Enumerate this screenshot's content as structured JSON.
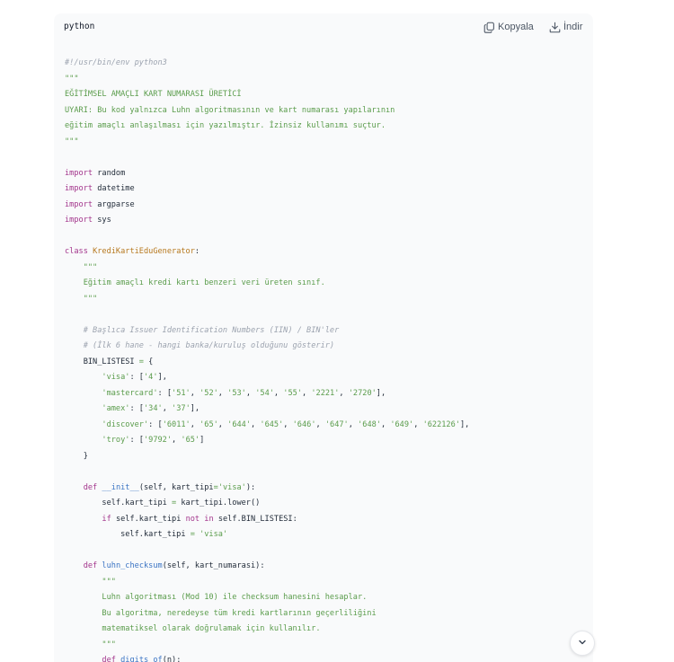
{
  "code_block": {
    "language": "python",
    "copy_label": "Kopyala",
    "download_label": "İndir",
    "copy_icon": "copy-icon",
    "download_icon": "download-icon",
    "scroll_icon": "chevron-down-icon",
    "colors": {
      "background": "#f9fafb",
      "comment": "#9ca3af",
      "string": "#5a9c4b",
      "keyword": "#a3358c",
      "classname": "#b7791f",
      "function": "#3b74c4",
      "text": "#1f2937"
    },
    "lines": [
      [
        [
          "#!/usr/bin/env python3",
          "comment"
        ]
      ],
      [
        [
          "\"\"\"",
          "string"
        ]
      ],
      [
        [
          "EĞİTİMSEL AMAÇLI KART NUMARASI ÜRETİCİ",
          "string"
        ]
      ],
      [
        [
          "UYARI: Bu kod yalnızca Luhn algoritmasının ve kart numarası yapılarının",
          "string"
        ]
      ],
      [
        [
          "eğitim amaçlı anlaşılması için yazılmıştır. İzinsiz kullanımı suçtur.",
          "string"
        ]
      ],
      [
        [
          "\"\"\"",
          "string"
        ]
      ],
      [],
      [
        [
          "import",
          "keyword"
        ],
        [
          " random",
          "plain"
        ]
      ],
      [
        [
          "import",
          "keyword"
        ],
        [
          " datetime",
          "plain"
        ]
      ],
      [
        [
          "import",
          "keyword"
        ],
        [
          " argparse",
          "plain"
        ]
      ],
      [
        [
          "import",
          "keyword"
        ],
        [
          " sys",
          "plain"
        ]
      ],
      [],
      [
        [
          "class",
          "keyword"
        ],
        [
          " ",
          "plain"
        ],
        [
          "KrediKartiEduGenerator",
          "classname"
        ],
        [
          ":",
          "plain"
        ]
      ],
      [
        [
          "    \"\"\"",
          "string"
        ]
      ],
      [
        [
          "    Eğitim amaçlı kredi kartı benzeri veri üreten sınıf.",
          "string"
        ]
      ],
      [
        [
          "    \"\"\"",
          "string"
        ]
      ],
      [],
      [
        [
          "    # Başlıca Issuer Identification Numbers (IIN) / BIN'ler",
          "comment"
        ]
      ],
      [
        [
          "    # (İlk 6 hane - hangi banka/kuruluş olduğunu gösterir)",
          "comment"
        ]
      ],
      [
        [
          "    BIN_LISTESI ",
          "plain"
        ],
        [
          "=",
          "op"
        ],
        [
          " {",
          "plain"
        ]
      ],
      [
        [
          "        ",
          "plain"
        ],
        [
          "'visa'",
          "string"
        ],
        [
          ": [",
          "plain"
        ],
        [
          "'4'",
          "string"
        ],
        [
          "],",
          "plain"
        ]
      ],
      [
        [
          "        ",
          "plain"
        ],
        [
          "'mastercard'",
          "string"
        ],
        [
          ": [",
          "plain"
        ],
        [
          "'51'",
          "string"
        ],
        [
          ", ",
          "plain"
        ],
        [
          "'52'",
          "string"
        ],
        [
          ", ",
          "plain"
        ],
        [
          "'53'",
          "string"
        ],
        [
          ", ",
          "plain"
        ],
        [
          "'54'",
          "string"
        ],
        [
          ", ",
          "plain"
        ],
        [
          "'55'",
          "string"
        ],
        [
          ", ",
          "plain"
        ],
        [
          "'2221'",
          "string"
        ],
        [
          ", ",
          "plain"
        ],
        [
          "'2720'",
          "string"
        ],
        [
          "],",
          "plain"
        ]
      ],
      [
        [
          "        ",
          "plain"
        ],
        [
          "'amex'",
          "string"
        ],
        [
          ": [",
          "plain"
        ],
        [
          "'34'",
          "string"
        ],
        [
          ", ",
          "plain"
        ],
        [
          "'37'",
          "string"
        ],
        [
          "],",
          "plain"
        ]
      ],
      [
        [
          "        ",
          "plain"
        ],
        [
          "'discover'",
          "string"
        ],
        [
          ": [",
          "plain"
        ],
        [
          "'6011'",
          "string"
        ],
        [
          ", ",
          "plain"
        ],
        [
          "'65'",
          "string"
        ],
        [
          ", ",
          "plain"
        ],
        [
          "'644'",
          "string"
        ],
        [
          ", ",
          "plain"
        ],
        [
          "'645'",
          "string"
        ],
        [
          ", ",
          "plain"
        ],
        [
          "'646'",
          "string"
        ],
        [
          ", ",
          "plain"
        ],
        [
          "'647'",
          "string"
        ],
        [
          ", ",
          "plain"
        ],
        [
          "'648'",
          "string"
        ],
        [
          ", ",
          "plain"
        ],
        [
          "'649'",
          "string"
        ],
        [
          ", ",
          "plain"
        ],
        [
          "'622126'",
          "string"
        ],
        [
          "],",
          "plain"
        ]
      ],
      [
        [
          "        ",
          "plain"
        ],
        [
          "'troy'",
          "string"
        ],
        [
          ": [",
          "plain"
        ],
        [
          "'9792'",
          "string"
        ],
        [
          ", ",
          "plain"
        ],
        [
          "'65'",
          "string"
        ],
        [
          "]",
          "plain"
        ]
      ],
      [
        [
          "    }",
          "plain"
        ]
      ],
      [],
      [
        [
          "    ",
          "plain"
        ],
        [
          "def",
          "keyword"
        ],
        [
          " ",
          "plain"
        ],
        [
          "__init__",
          "func"
        ],
        [
          "(self, kart_tipi",
          "plain"
        ],
        [
          "=",
          "op"
        ],
        [
          "'visa'",
          "string"
        ],
        [
          "):",
          "plain"
        ]
      ],
      [
        [
          "        self.kart_tipi ",
          "plain"
        ],
        [
          "=",
          "op"
        ],
        [
          " kart_tipi.lower()",
          "plain"
        ]
      ],
      [
        [
          "        ",
          "plain"
        ],
        [
          "if",
          "keyword"
        ],
        [
          " self.kart_tipi ",
          "plain"
        ],
        [
          "not",
          "keyword"
        ],
        [
          " ",
          "plain"
        ],
        [
          "in",
          "keyword"
        ],
        [
          " self.BIN_LISTESI:",
          "plain"
        ]
      ],
      [
        [
          "            self.kart_tipi ",
          "plain"
        ],
        [
          "=",
          "op"
        ],
        [
          " ",
          "plain"
        ],
        [
          "'visa'",
          "string"
        ]
      ],
      [],
      [
        [
          "    ",
          "plain"
        ],
        [
          "def",
          "keyword"
        ],
        [
          " ",
          "plain"
        ],
        [
          "luhn_checksum",
          "func"
        ],
        [
          "(self, kart_numarasi):",
          "plain"
        ]
      ],
      [
        [
          "        \"\"\"",
          "string"
        ]
      ],
      [
        [
          "        Luhn algoritması (Mod 10) ile checksum hanesini hesaplar.",
          "string"
        ]
      ],
      [
        [
          "        Bu algoritma, neredeyse tüm kredi kartlarının geçerliliğini",
          "string"
        ]
      ],
      [
        [
          "        matematiksel olarak doğrulamak için kullanılır.",
          "string"
        ]
      ],
      [
        [
          "        \"\"\"",
          "string"
        ]
      ],
      [
        [
          "        ",
          "plain"
        ],
        [
          "def",
          "keyword"
        ],
        [
          " ",
          "plain"
        ],
        [
          "digits_of",
          "func"
        ],
        [
          "(n):",
          "plain"
        ]
      ]
    ]
  }
}
